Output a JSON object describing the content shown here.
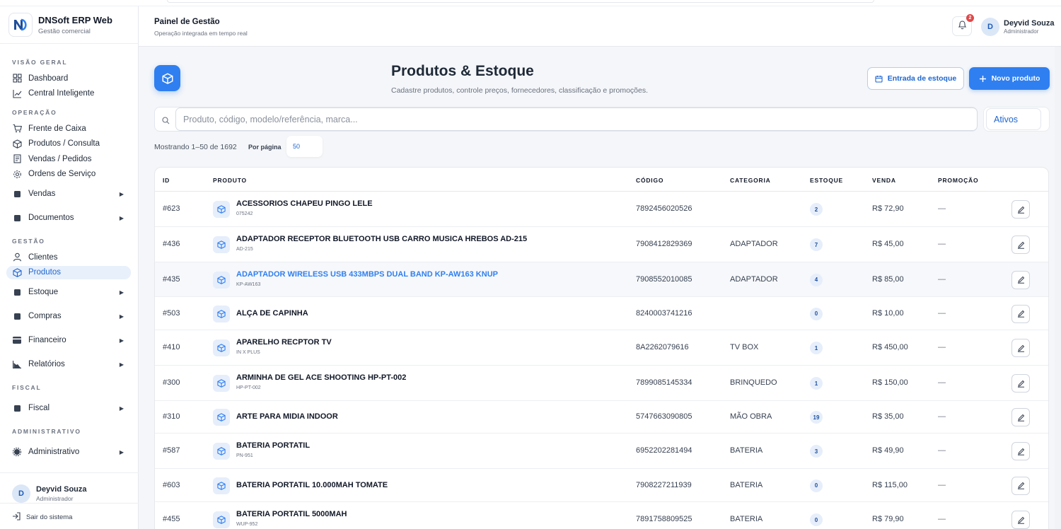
{
  "app": {
    "title": "DNSoft ERP Web",
    "subtitle": "Gestão comercial"
  },
  "sidebar": {
    "sections": {
      "visao_geral": "VISÃO GERAL",
      "operacao": "OPERAÇÃO",
      "gestao": "GESTÃO",
      "fiscal": "FISCAL",
      "administrativo": "ADMINISTRATIVO"
    },
    "items": {
      "dashboard": "Dashboard",
      "central": "Central Inteligente",
      "frente_caixa": "Frente de Caixa",
      "produtos_consulta": "Produtos / Consulta",
      "vendas_pedidos": "Vendas / Pedidos",
      "ordens_servico": "Ordens de Serviço",
      "vendas": "Vendas",
      "documentos": "Documentos",
      "clientes": "Clientes",
      "produtos": "Produtos",
      "estoque": "Estoque",
      "compras": "Compras",
      "financeiro": "Financeiro",
      "relatorios": "Relatórios",
      "fiscal": "Fiscal",
      "administrativo": "Administrativo"
    },
    "user": {
      "initial": "D",
      "name": "Deyvid Souza",
      "role": "Administrador"
    },
    "logout": "Sair do sistema"
  },
  "header": {
    "title": "Painel de Gestão",
    "subtitle": "Operação integrada em tempo real",
    "notifications": "2",
    "user": {
      "initial": "D",
      "name": "Deyvid Souza",
      "role": "Administrador"
    }
  },
  "page": {
    "title": "Produtos & Estoque",
    "subtitle": "Cadastre produtos, controle preços, fornecedores, classificação e promoções.",
    "entrada_label": "Entrada de estoque",
    "novo_label": "Novo produto",
    "search_placeholder": "Produto, código, modelo/referência, marca...",
    "filter_value": "Ativos",
    "showing": "Mostrando 1–50 de 1692",
    "per_page_label": "Por página",
    "per_page_value": "50"
  },
  "table": {
    "columns": {
      "id": "ID",
      "produto": "PRODUTO",
      "codigo": "CÓDIGO",
      "categoria": "CATEGORIA",
      "estoque": "ESTOQUE",
      "venda": "VENDA",
      "promocao": "PROMOÇÃO"
    },
    "rows": [
      {
        "id": "#623",
        "name": "ACESSORIOS CHAPEU PINGO LELE",
        "ref": "075242",
        "code": "7892456020526",
        "category": "",
        "stock": "2",
        "price": "R$ 72,90",
        "promo": "—"
      },
      {
        "id": "#436",
        "name": "ADAPTADOR RECEPTOR BLUETOOTH USB CARRO MUSICA HREBOS AD-215",
        "ref": "AD-215",
        "code": "7908412829369",
        "category": "ADAPTADOR",
        "stock": "7",
        "price": "R$ 45,00",
        "promo": "—"
      },
      {
        "id": "#435",
        "name": "ADAPTADOR WIRELESS USB 433MBPS DUAL BAND KP-AW163 KNUP",
        "ref": "KP-AW163",
        "code": "7908552010085",
        "category": "ADAPTADOR",
        "stock": "4",
        "price": "R$ 85,00",
        "promo": "—"
      },
      {
        "id": "#503",
        "name": "ALÇA DE CAPINHA",
        "ref": "",
        "code": "8240003741216",
        "category": "",
        "stock": "0",
        "price": "R$ 10,00",
        "promo": "—"
      },
      {
        "id": "#410",
        "name": "APARELHO RECPTOR TV",
        "ref": "IN X PLUS",
        "code": "8A2262079616",
        "category": "TV BOX",
        "stock": "1",
        "price": "R$ 450,00",
        "promo": "—"
      },
      {
        "id": "#300",
        "name": "ARMINHA DE GEL ACE SHOOTING HP-PT-002",
        "ref": "HP-PT-002",
        "code": "7899085145334",
        "category": "BRINQUEDO",
        "stock": "1",
        "price": "R$ 150,00",
        "promo": "—"
      },
      {
        "id": "#310",
        "name": "ARTE PARA MIDIA INDOOR",
        "ref": "",
        "code": "5747663090805",
        "category": "MÃO OBRA",
        "stock": "19",
        "price": "R$ 35,00",
        "promo": "—"
      },
      {
        "id": "#587",
        "name": "BATERIA PORTATIL",
        "ref": "PN-951",
        "code": "6952202281494",
        "category": "BATERIA",
        "stock": "3",
        "price": "R$ 49,90",
        "promo": "—"
      },
      {
        "id": "#603",
        "name": "BATERIA PORTATIL 10.000MAH TOMATE",
        "ref": "",
        "code": "7908227211939",
        "category": "BATERIA",
        "stock": "0",
        "price": "R$ 115,00",
        "promo": "—"
      },
      {
        "id": "#455",
        "name": "BATERIA PORTATIL 5000MAH",
        "ref": "WUP-952",
        "code": "7891758809525",
        "category": "BATERIA",
        "stock": "0",
        "price": "R$ 79,90",
        "promo": "—"
      }
    ]
  },
  "colors": {
    "accent": "#2f7ff0",
    "link": "#1e66d0",
    "badge": "#e04848"
  }
}
